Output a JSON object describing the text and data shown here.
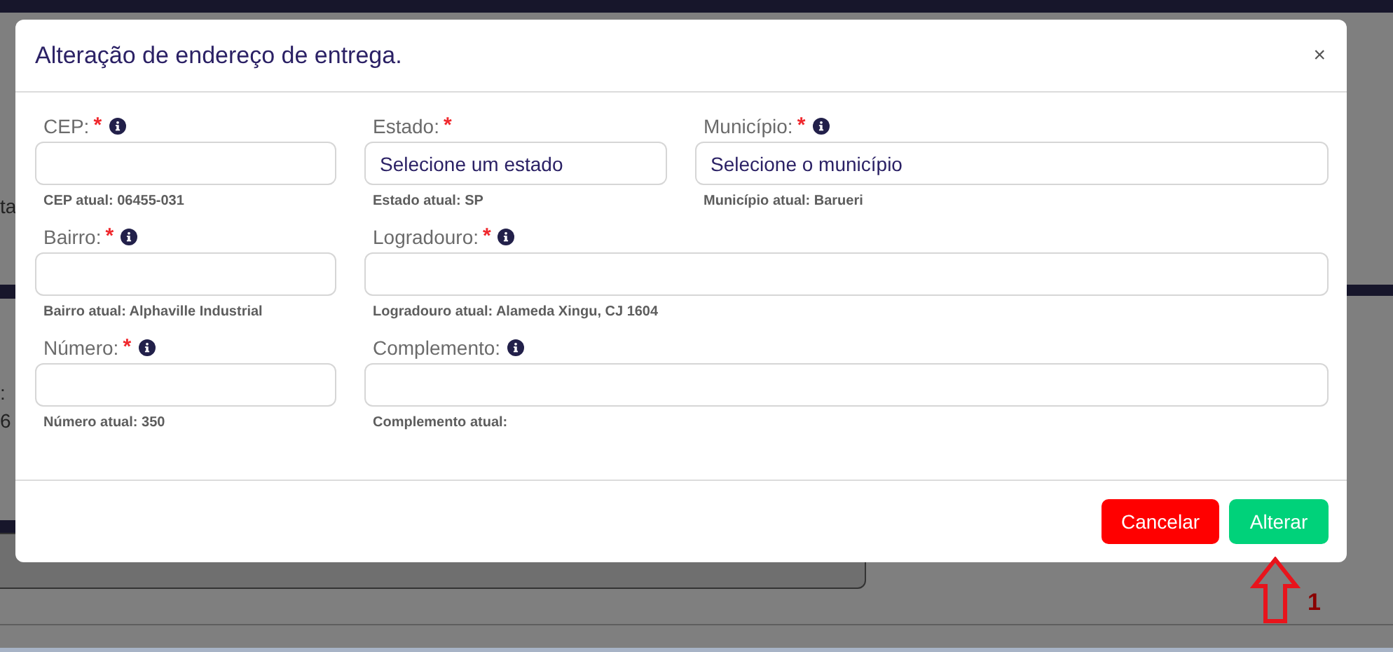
{
  "background_fragments": [
    {
      "text": "ta"
    },
    {
      "text": ":"
    },
    {
      "text": "6"
    }
  ],
  "dialog": {
    "title": "Alteração de endereço de entrega.",
    "close": "×"
  },
  "required_mark": "*",
  "form_rows": [
    [
      {
        "label": "CEP:",
        "required": true,
        "info": true,
        "hint": "CEP atual: 06455-031"
      },
      {
        "label": "Estado:",
        "required": true,
        "info": false,
        "placeholder": "Selecione um estado",
        "hint": "Estado atual: SP"
      },
      {
        "label": "Município:",
        "required": true,
        "info": true,
        "placeholder": "Selecione o município",
        "hint": "Município atual: Barueri"
      }
    ],
    [
      {
        "label": "Bairro:",
        "required": true,
        "info": true,
        "hint": "Bairro atual: Alphaville Industrial"
      },
      {
        "label": "Logradouro:",
        "required": true,
        "info": true,
        "hint": "Logradouro atual: Alameda Xingu, CJ 1604"
      }
    ],
    [
      {
        "label": "Número:",
        "required": true,
        "info": true,
        "hint": "Número atual: 350"
      },
      {
        "label": "Complemento:",
        "required": false,
        "info": true,
        "hint": "Complemento atual:"
      }
    ]
  ],
  "buttons": [
    {
      "label": "Cancelar",
      "kind": "danger"
    },
    {
      "label": "Alterar",
      "kind": "success"
    }
  ],
  "annotation": {
    "label": "1"
  }
}
